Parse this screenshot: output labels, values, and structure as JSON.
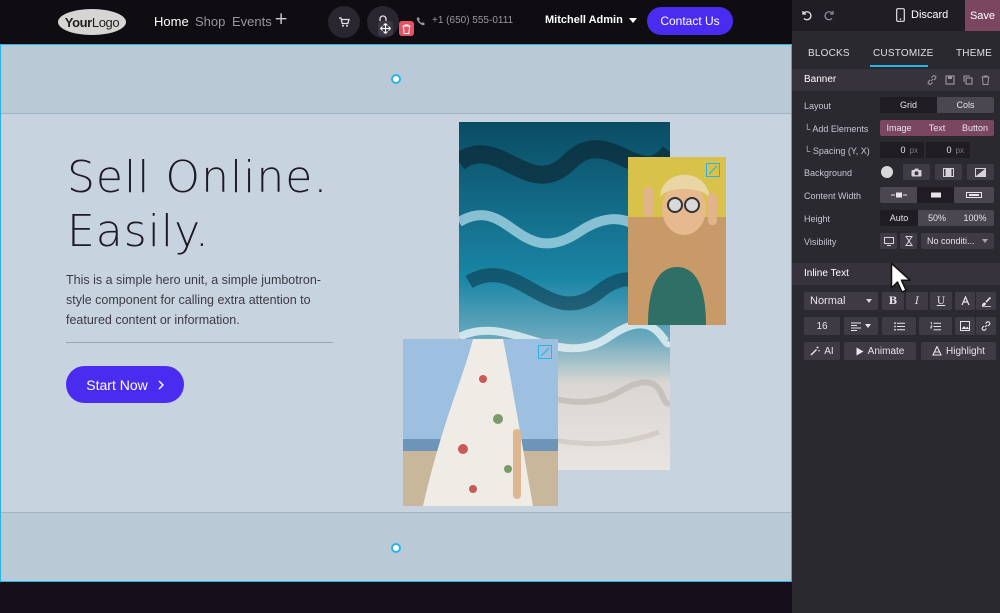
{
  "website": {
    "logo": {
      "bold": "Your",
      "regular": "Logo"
    },
    "nav": [
      {
        "label": "Home",
        "active": true
      },
      {
        "label": "Shop",
        "active": false
      },
      {
        "label": "Events",
        "active": false
      }
    ],
    "nav_add_icon": "plus-icon",
    "phone": "+1 (650) 555-0111",
    "user": "Mitchell Admin",
    "contact_button": "Contact Us",
    "hero": {
      "title_line1": "Sell Online.",
      "title_line2": "Easily.",
      "lead": "This is a simple hero unit, a simple jumbotron-style component for calling extra attention to featured content or information.",
      "button": "Start Now"
    }
  },
  "editor": {
    "discard": "Discard",
    "save": "Save",
    "tabs": [
      {
        "label": "BLOCKS",
        "active": false
      },
      {
        "label": "CUSTOMIZE",
        "active": true
      },
      {
        "label": "THEME",
        "active": false
      }
    ],
    "banner": {
      "title": "Banner",
      "layout_label": "Layout",
      "layout_options": [
        "Grid",
        "Cols"
      ],
      "add_elements_label": "Add Elements",
      "add_elements_options": [
        "Image",
        "Text",
        "Button"
      ],
      "spacing_label": "Spacing (Y, X)",
      "spacing_y": "0",
      "spacing_x": "0",
      "spacing_unit": "px",
      "background_label": "Background",
      "content_width_label": "Content Width",
      "height_label": "Height",
      "height_options": [
        "Auto",
        "50%",
        "100%"
      ],
      "visibility_label": "Visibility",
      "visibility_value": "No conditi..."
    },
    "inline_text": {
      "title": "Inline Text",
      "style_value": "Normal",
      "bold": "B",
      "italic": "I",
      "underline": "U",
      "font_size": "16",
      "ai_button": "AI",
      "animate_button": "Animate",
      "highlight_button": "Highlight"
    }
  },
  "colors": {
    "primary": "#4a2cf0",
    "save_button": "#7a4660",
    "selection": "#28b5e6",
    "banner_bg": "#c7d4df"
  }
}
